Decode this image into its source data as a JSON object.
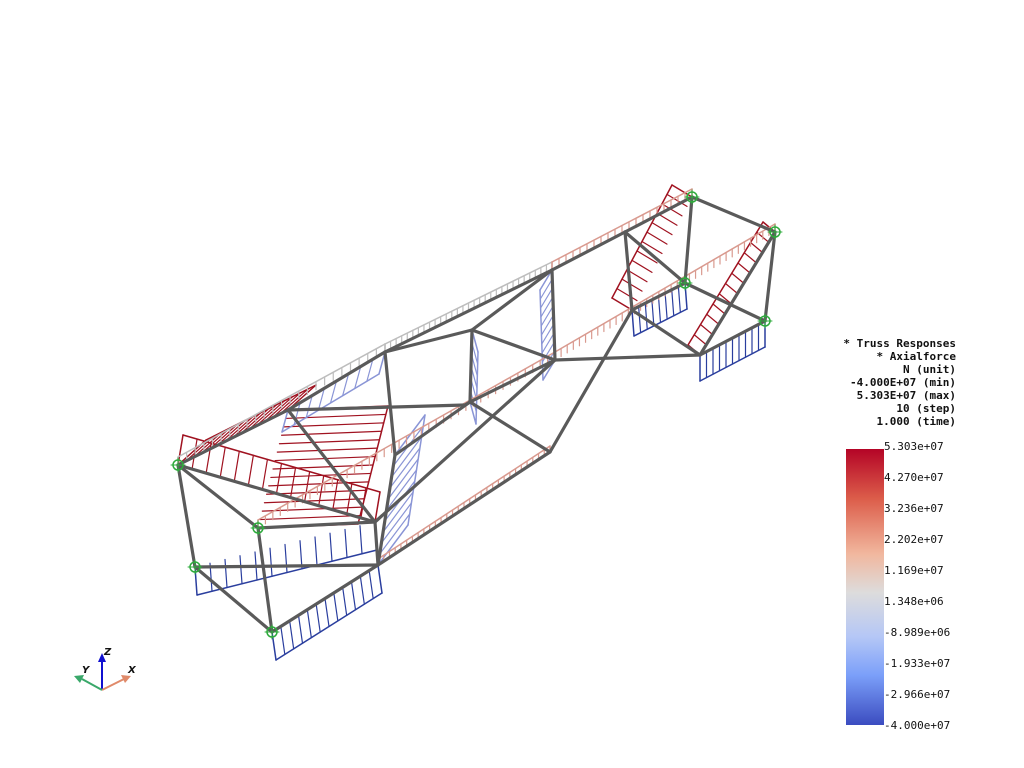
{
  "info": {
    "lines": [
      "* Truss Responses",
      "* Axialforce",
      "N (unit)",
      "-4.000E+07 (min)",
      "5.303E+07 (max)",
      "10 (step)",
      "1.000 (time)"
    ]
  },
  "colorbar": {
    "ticks": [
      "5.303e+07",
      "4.270e+07",
      "3.236e+07",
      "2.202e+07",
      "1.169e+07",
      "1.348e+06",
      "-8.989e+06",
      "-1.933e+07",
      "-2.966e+07",
      "-4.000e+07"
    ],
    "max_color": "#b40426",
    "min_color": "#3b4cc0",
    "mid_color": "#dddcdc"
  },
  "axes": {
    "x": "X",
    "y": "Y",
    "z": "Z"
  },
  "colors": {
    "member": "#5a5a5a",
    "tension": "#a01220",
    "compression": "#2a3e9e",
    "support": "#2eab3c"
  }
}
